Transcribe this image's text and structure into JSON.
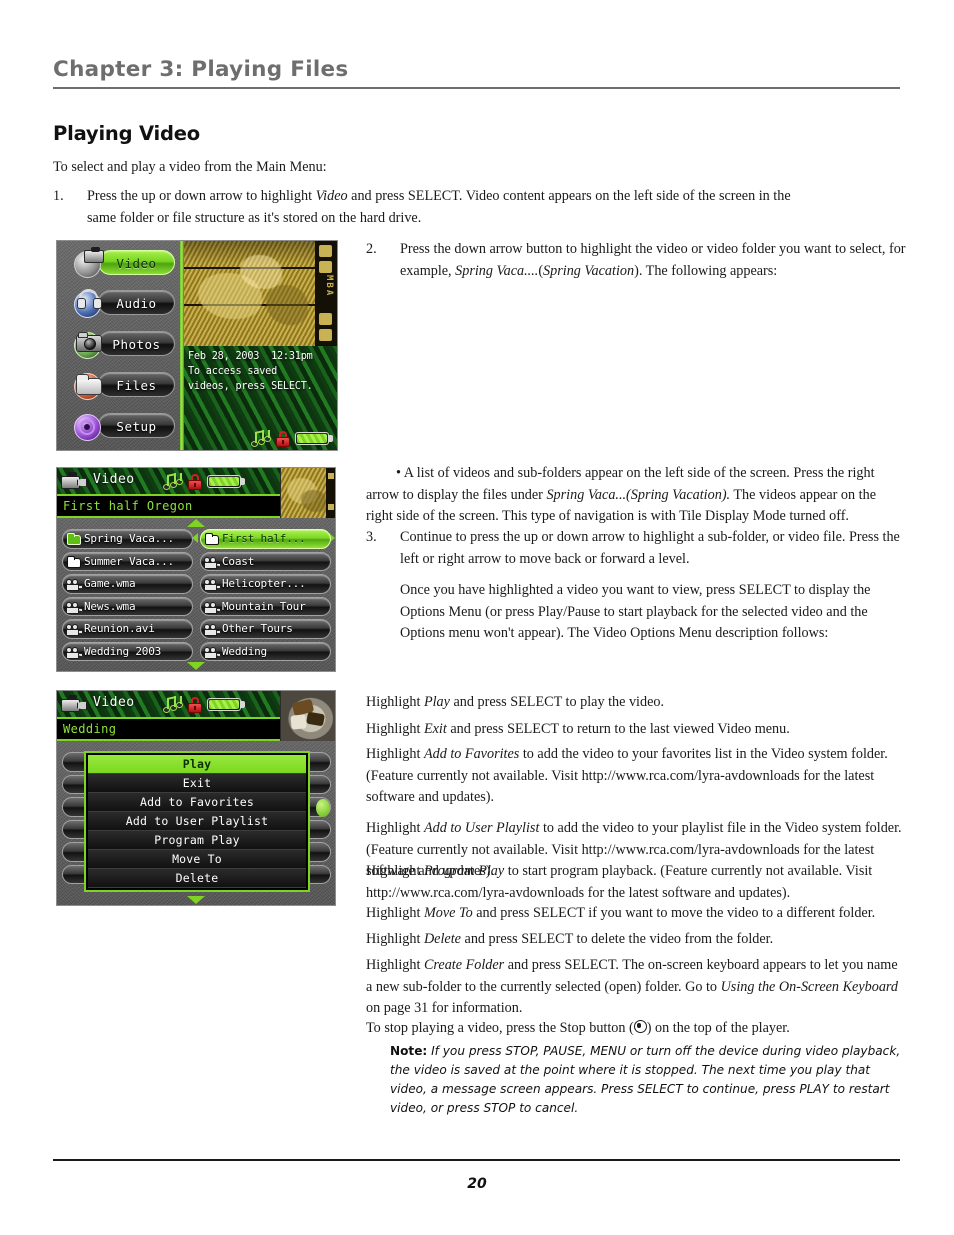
{
  "header": {
    "chapter": "Chapter 3: Playing Files"
  },
  "section": {
    "title": "Playing Video",
    "intro": "To select and play a video from the Main Menu:"
  },
  "steps": {
    "one_num": "1.",
    "one_text": "Press the up or down arrow to highlight Video and press SELECT. Video content appears on the left side of the screen in the same folder or file structure as it's stored on the hard drive.",
    "two_num": "2.",
    "two_text": "Press the down arrow button to highlight the video or video folder you want to select, for example, Spring Vaca....(Spring Vacation). The following appears:",
    "bullet_text": "• A list of videos and sub-folders appear on the left side of the screen. Press the right arrow to display the files under Spring Vaca...(Spring Vacation). The videos appear on the right side of the screen. This type of navigation is with Tile Display Mode turned off.",
    "three_num": "3.",
    "three_text": "Continue to press the up or down arrow to highlight a sub-folder, or video file. Press the left or right arrow to move back or forward a level.",
    "three_para2": "Once you have highlighted a video you want to view, press SELECT to display the Options Menu (or press Play/Pause to start playback for the selected video and the Options menu won't appear). The Video Options Menu description follows:"
  },
  "descriptions": {
    "play": "Highlight Play and press SELECT to play the video.",
    "exit": "Highlight Exit and press SELECT to return to the last viewed Video menu.",
    "favorites": "Highlight Add to Favorites to add the video to your favorites list in the Video system folder. (Feature currently not available. Visit http://www.rca.com/lyra-avdownloads for the latest software and updates).",
    "playlist": "Highlight Add to User Playlist to add the video to your playlist file in the Video system folder. (Feature currently not available. Visit http://www.rca.com/lyra-avdownloads for the latest software and updates).",
    "program_play": "Highlight Program Play to start program playback. (Feature currently not available. Visit http://www.rca.com/lyra-avdownloads for the latest software and updates).",
    "move_to": "Highlight Move To and press SELECT if you want to move the video to a different folder.",
    "delete": "Highlight Delete and press SELECT to delete the video from the folder.",
    "create_folder": "Highlight Create Folder and press SELECT. The on-screen keyboard appears to let you name a new sub-folder to the currently selected (open) folder. Go to Using the On-Screen Keyboard on page 31 for information.",
    "stop": "To stop playing a video, press the Stop button ( ) on the top of the player."
  },
  "note": {
    "label": "Note:",
    "text": " If you press STOP, PAUSE, MENU or turn off the device during video playback, the video is saved at the point where it is stopped. The next time you play that video, a message screen appears. Press SELECT to continue, press PLAY to restart video, or press STOP to cancel."
  },
  "footer": {
    "page_number": "20"
  },
  "device_main_menu": {
    "items": [
      {
        "label": "Video",
        "selected": true,
        "icon": "camcorder-icon"
      },
      {
        "label": "Audio",
        "selected": false,
        "icon": "headphones-icon"
      },
      {
        "label": "Photos",
        "selected": false,
        "icon": "camera-icon"
      },
      {
        "label": "Files",
        "selected": false,
        "icon": "folder-icon"
      },
      {
        "label": "Setup",
        "selected": false,
        "icon": "gear-icon"
      }
    ],
    "info_line1": "Feb 28, 2003  12:31pm",
    "info_line2": "To access saved",
    "info_line3": "videos, press SELECT.",
    "film_label": "MBA",
    "status_icons": [
      "music-note-icon",
      "lock-icon",
      "battery-icon"
    ]
  },
  "device_browser": {
    "title": "Video",
    "breadcrumb": "First half Oregon",
    "left_column": [
      {
        "label": "Spring Vaca...",
        "icon": "folder-open-icon",
        "selected": false
      },
      {
        "label": "Summer Vaca...",
        "icon": "folder-closed-icon",
        "selected": false
      },
      {
        "label": "Game.wma",
        "icon": "movie-icon",
        "selected": false
      },
      {
        "label": "News.wma",
        "icon": "movie-icon",
        "selected": false
      },
      {
        "label": "Reunion.avi",
        "icon": "movie-icon",
        "selected": false
      },
      {
        "label": "Wedding 2003",
        "icon": "movie-icon",
        "selected": false
      }
    ],
    "right_column": [
      {
        "label": "First half...",
        "icon": "folder-closed-icon",
        "selected": true
      },
      {
        "label": "Coast",
        "icon": "movie-icon",
        "selected": false
      },
      {
        "label": "Helicopter...",
        "icon": "movie-icon",
        "selected": false
      },
      {
        "label": "Mountain Tour",
        "icon": "movie-icon",
        "selected": false
      },
      {
        "label": "Other Tours",
        "icon": "movie-icon",
        "selected": false
      },
      {
        "label": "Wedding",
        "icon": "movie-icon",
        "selected": false
      }
    ],
    "status_icons": [
      "music-note-icon",
      "lock-icon",
      "battery-icon"
    ]
  },
  "device_options": {
    "title": "Video",
    "breadcrumb": "Wedding",
    "menu": [
      {
        "label": "Play",
        "selected": true
      },
      {
        "label": "Exit",
        "selected": false
      },
      {
        "label": "Add to Favorites",
        "selected": false
      },
      {
        "label": "Add to User Playlist",
        "selected": false
      },
      {
        "label": "Program Play",
        "selected": false
      },
      {
        "label": "Move To",
        "selected": false
      },
      {
        "label": "Delete",
        "selected": false
      }
    ],
    "status_icons": [
      "music-note-icon",
      "lock-icon",
      "battery-icon"
    ]
  },
  "colors": {
    "accent_green": "#7fd421",
    "header_gray": "#6e6e6e",
    "screen_dark": "#3a3a3a"
  }
}
